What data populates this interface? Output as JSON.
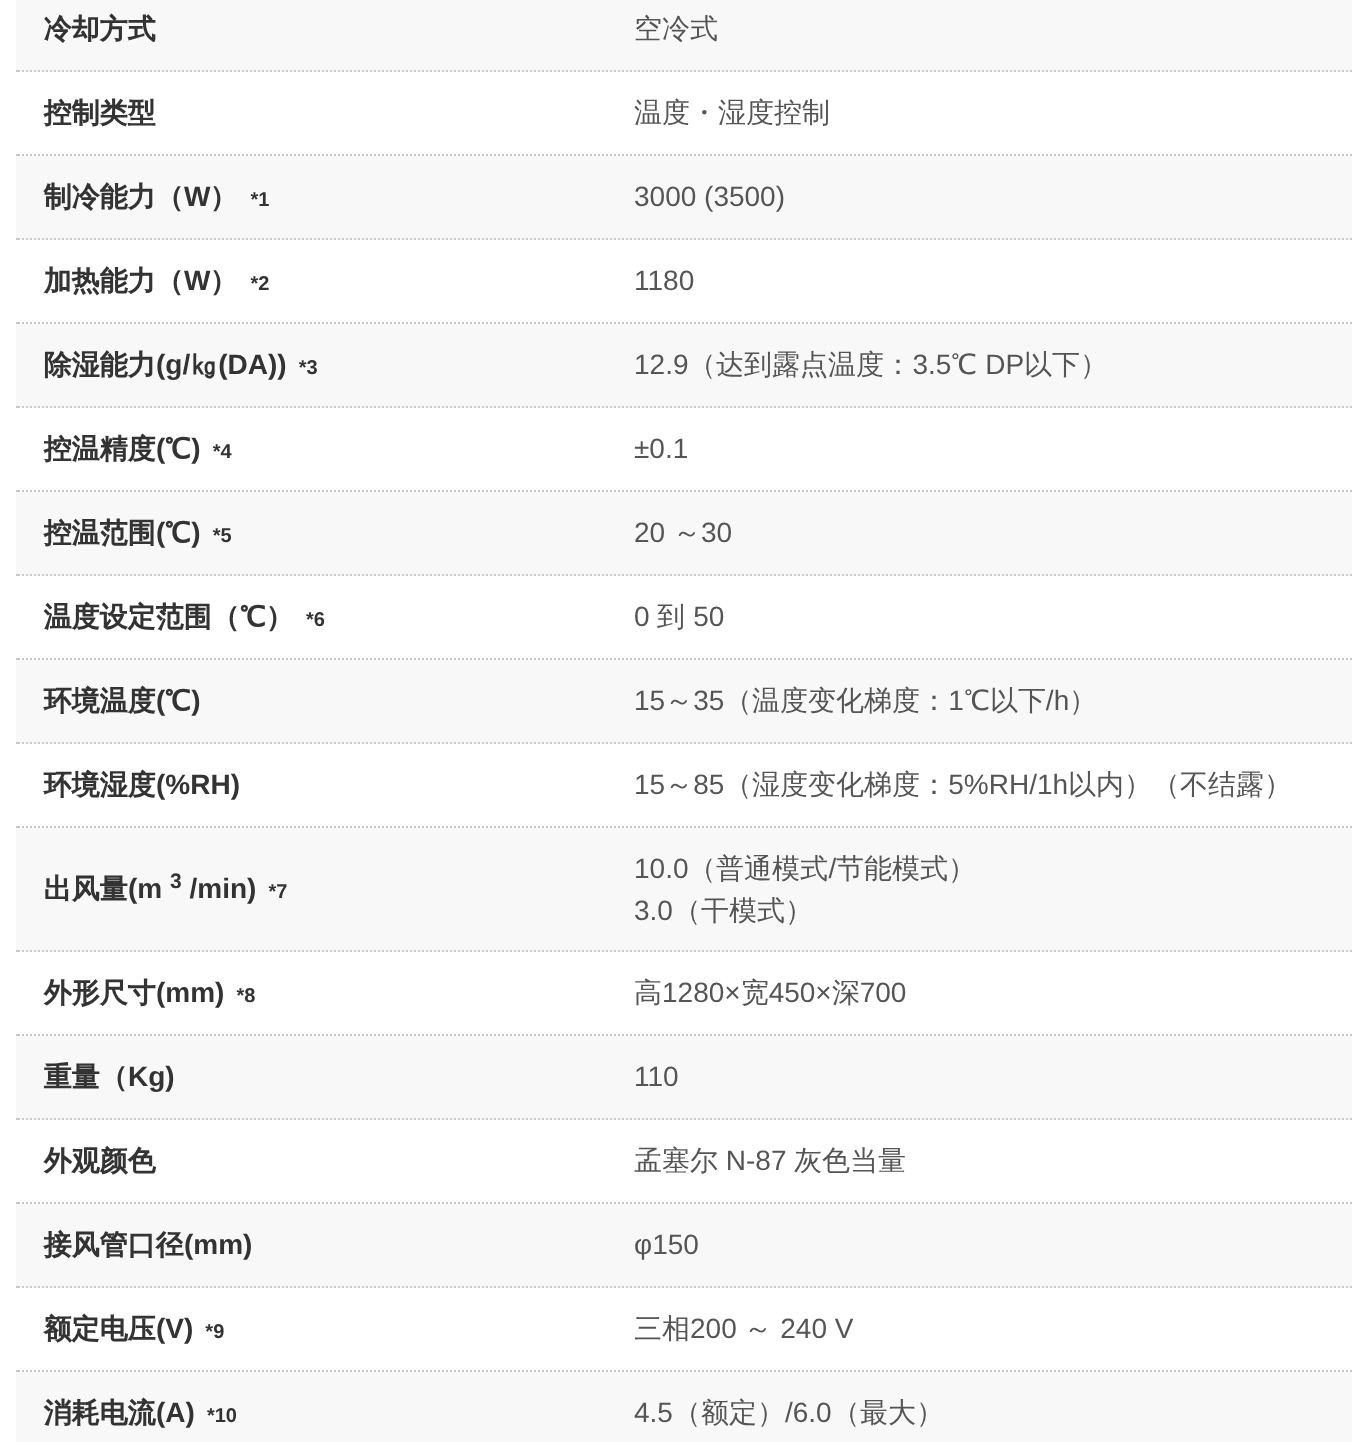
{
  "spec_table": {
    "rows": [
      {
        "label": "冷却方式",
        "values": [
          "空冷式"
        ]
      },
      {
        "label": "控制类型",
        "values": [
          "温度・湿度控制"
        ]
      },
      {
        "label": "制冷能力（W）",
        "note": "*1",
        "values": [
          "3000 (3500)"
        ]
      },
      {
        "label": "加热能力（W）",
        "note": "*2",
        "values": [
          "1180"
        ]
      },
      {
        "label": "除湿能力(g/㎏(DA))",
        "note": "*3",
        "values": [
          "12.9（达到露点温度：3.5℃ DP以下）"
        ]
      },
      {
        "label": "控温精度(℃)",
        "note": "*4",
        "values": [
          "±0.1"
        ]
      },
      {
        "label": "控温范围(℃)",
        "note": "*5",
        "values": [
          "20 ～30"
        ]
      },
      {
        "label": "温度设定范围（℃）",
        "note": "*6",
        "values": [
          "0 到 50"
        ]
      },
      {
        "label": "环境温度(℃)",
        "values": [
          "15～35（温度变化梯度：1℃以下/h）"
        ]
      },
      {
        "label": "环境湿度(%RH)",
        "values": [
          "15～85（湿度变化梯度：5%RH/1h以内）（不结露）"
        ]
      },
      {
        "label": "出风量(m $^{3}$ /min)",
        "note": "*7",
        "values": [
          "10.0（普通模式/节能模式）",
          "3.0（干模式）"
        ]
      },
      {
        "label": "外形尺寸(mm)",
        "note": "*8",
        "values": [
          "高1280×宽450×深700"
        ]
      },
      {
        "label": "重量（Kg)",
        "values": [
          "110"
        ]
      },
      {
        "label": "外观颜色",
        "values": [
          "孟塞尔 N-87 灰色当量"
        ]
      },
      {
        "label": "接风管口径(mm)",
        "values": [
          "φ150"
        ]
      },
      {
        "label": "额定电压(V)",
        "note": "*9",
        "values": [
          "三相200 ～ 240 V"
        ]
      },
      {
        "label": "消耗电流(A)",
        "note": "*10",
        "values": [
          "4.5（额定）/6.0（最大）"
        ]
      }
    ]
  }
}
